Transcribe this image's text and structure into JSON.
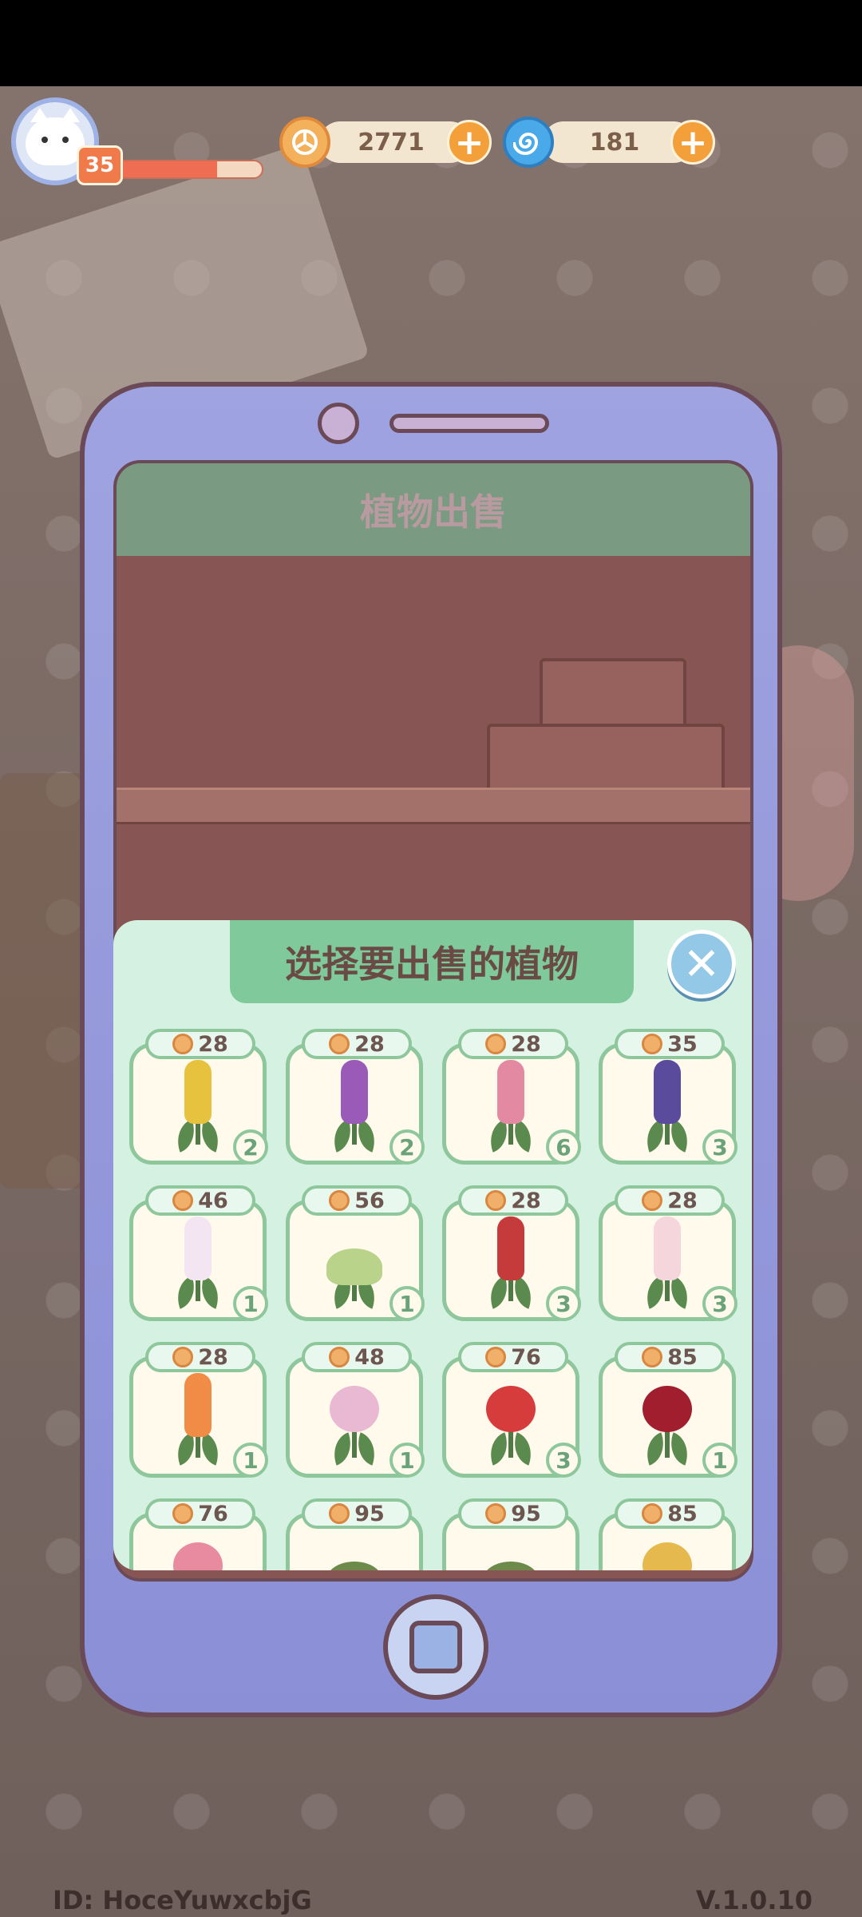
{
  "hud": {
    "player_level": "35",
    "xp_progress": 0.7,
    "gold_value": "2771",
    "gems_value": "181",
    "gold_icon": "coin-icon",
    "gem_icon": "spiral-gem-icon",
    "add_icon": "plus-icon"
  },
  "phone": {
    "screen_title": "植物出售"
  },
  "sell_panel": {
    "title": "选择要出售的植物",
    "close_icon": "close-icon",
    "items": [
      {
        "price": "28",
        "count": "2",
        "color": "#e7c23e",
        "kind": "hyacinth"
      },
      {
        "price": "28",
        "count": "2",
        "color": "#9a5bb8",
        "kind": "hyacinth"
      },
      {
        "price": "28",
        "count": "6",
        "color": "#e38aa2",
        "kind": "hyacinth"
      },
      {
        "price": "35",
        "count": "3",
        "color": "#5b4b9c",
        "kind": "hyacinth"
      },
      {
        "price": "46",
        "count": "1",
        "color": "#f3e6f2",
        "kind": "hyacinth"
      },
      {
        "price": "56",
        "count": "1",
        "color": "#b9d38a",
        "kind": "shrub"
      },
      {
        "price": "28",
        "count": "3",
        "color": "#c53a3a",
        "kind": "hyacinth"
      },
      {
        "price": "28",
        "count": "3",
        "color": "#f4d6dc",
        "kind": "hyacinth"
      },
      {
        "price": "28",
        "count": "1",
        "color": "#f08c45",
        "kind": "hyacinth"
      },
      {
        "price": "48",
        "count": "1",
        "color": "#e9b8d2",
        "kind": "flower"
      },
      {
        "price": "76",
        "count": "3",
        "color": "#d63c3c",
        "kind": "flower"
      },
      {
        "price": "85",
        "count": "1",
        "color": "#a01e2e",
        "kind": "flower"
      },
      {
        "price": "76",
        "count": "",
        "color": "#e88aa0",
        "kind": "flower"
      },
      {
        "price": "95",
        "count": "",
        "color": "#6d8a4a",
        "kind": "shrub"
      },
      {
        "price": "95",
        "count": "",
        "color": "#6d8a4a",
        "kind": "shrub"
      },
      {
        "price": "85",
        "count": "",
        "color": "#e6b94f",
        "kind": "flower"
      }
    ]
  },
  "footer": {
    "player_id": "ID:  HoceYuwxcbjG",
    "version": "V.1.0.10"
  }
}
